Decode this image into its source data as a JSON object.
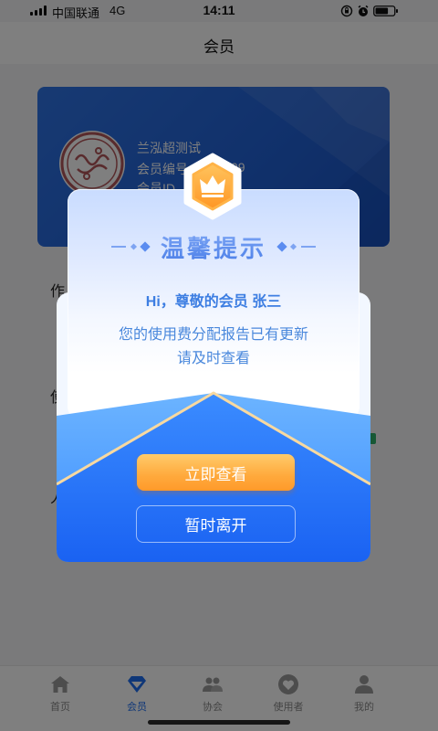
{
  "status_bar": {
    "carrier": "中国联通",
    "network": "4G",
    "time": "14:11",
    "signal_bars": 4,
    "battery_level": 0.7,
    "icons": [
      "rotation-lock-icon",
      "alarm-icon",
      "battery-icon"
    ]
  },
  "nav": {
    "title": "会员"
  },
  "member_card": {
    "name": "兰泓超测试",
    "number_label": "会员编号",
    "number_tail": "09",
    "id_label": "会员ID",
    "avatar_icon": "seal-logo-icon"
  },
  "underlying_list": [
    {
      "label": "作"
    },
    {
      "label": "使"
    },
    {
      "label": "人"
    }
  ],
  "modal": {
    "badge_icon": "crown-icon",
    "title": "温馨提示",
    "greeting": "Hi，尊敬的会员 张三",
    "message_line1": "您的使用费分配报告已有更新",
    "message_line2": "请及时查看",
    "primary_button": "立即查看",
    "secondary_button": "暂时离开"
  },
  "tab_bar": [
    {
      "label": "首页",
      "icon": "home-icon",
      "active": false
    },
    {
      "label": "会员",
      "icon": "member-diamond-icon",
      "active": true
    },
    {
      "label": "协会",
      "icon": "association-icon",
      "active": false
    },
    {
      "label": "使用者",
      "icon": "user-heart-icon",
      "active": false
    },
    {
      "label": "我的",
      "icon": "profile-icon",
      "active": false
    }
  ],
  "colors": {
    "accent": "#1e6ef0",
    "card_blue": "#2263d8",
    "button_orange": "#ffa93c",
    "envelope_blue": "#2f7cf8",
    "gold_line": "#f8d9a0"
  }
}
